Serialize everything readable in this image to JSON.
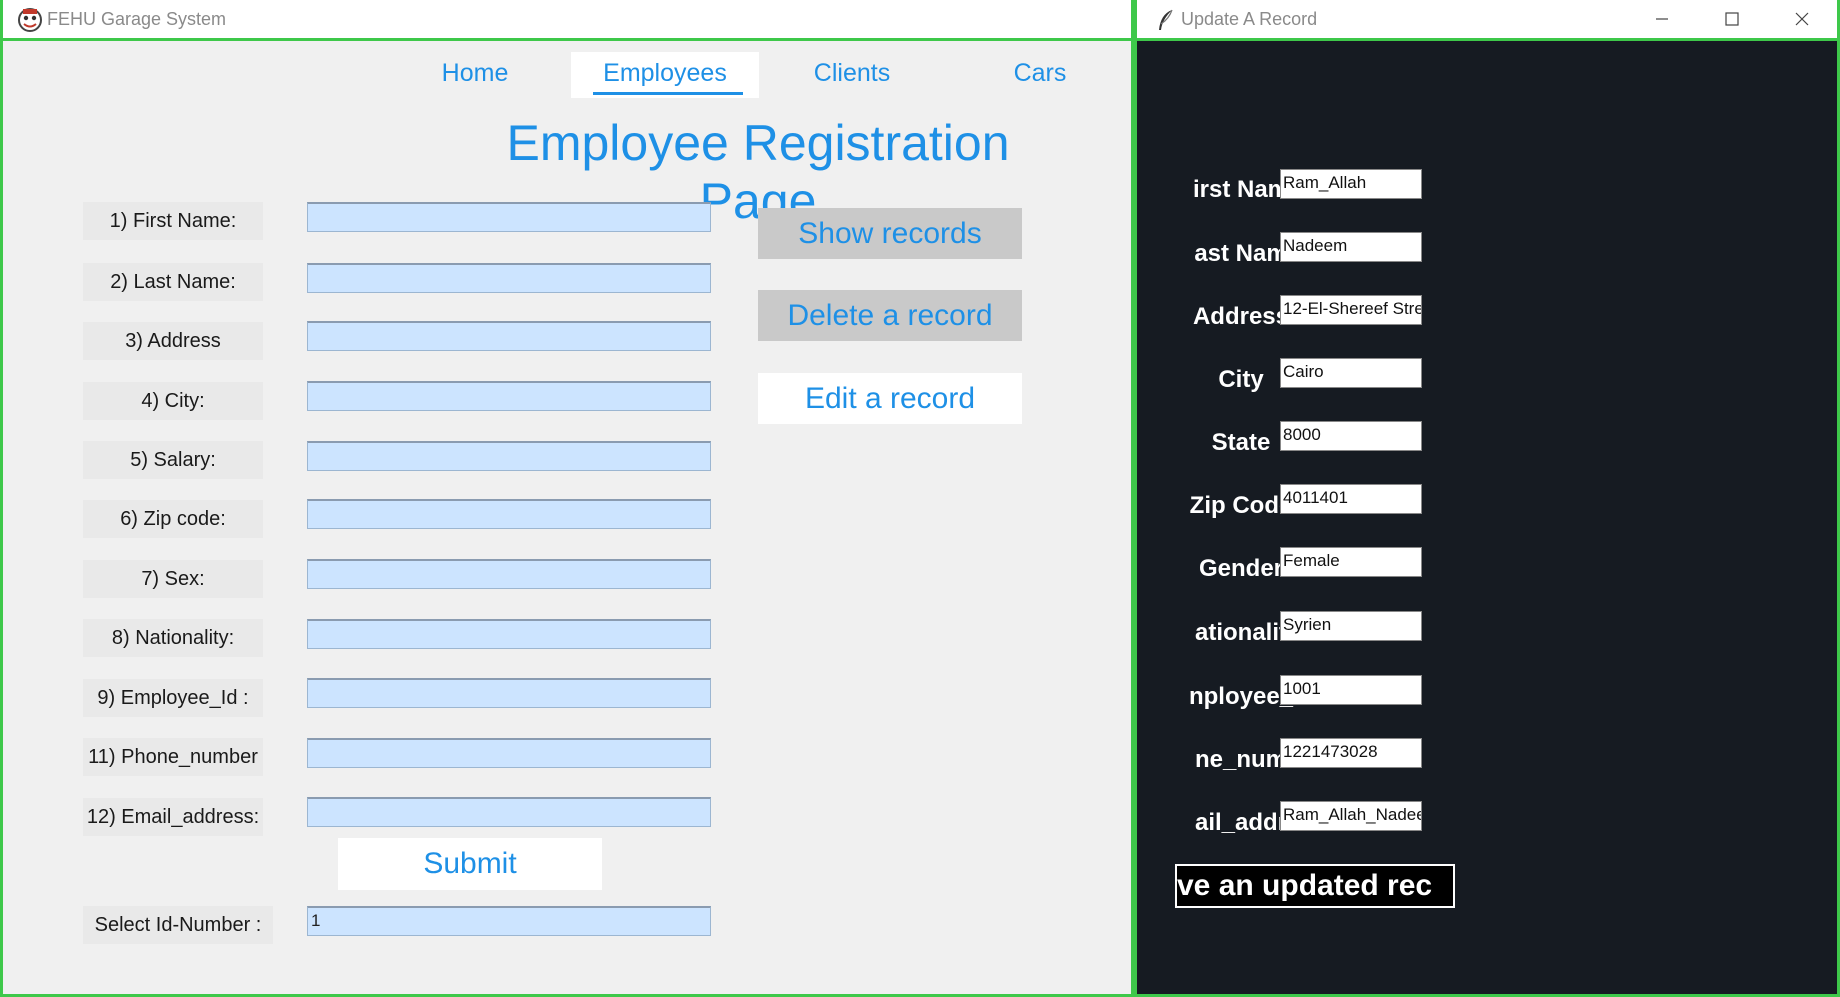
{
  "left_window": {
    "title": "FEHU Garage System",
    "tabs": [
      {
        "label": "Home",
        "active": false
      },
      {
        "label": "Employees",
        "active": true
      },
      {
        "label": "Clients",
        "active": false
      },
      {
        "label": "Cars",
        "active": false
      }
    ],
    "page_title": "Employee Registration Page",
    "form_fields": [
      {
        "label": "1) First Name:",
        "value": ""
      },
      {
        "label": "2) Last Name:",
        "value": ""
      },
      {
        "label": "3) Address",
        "value": ""
      },
      {
        "label": "4) City:",
        "value": ""
      },
      {
        "label": "5) Salary:",
        "value": ""
      },
      {
        "label": "6) Zip code:",
        "value": ""
      },
      {
        "label": "7) Sex:",
        "value": ""
      },
      {
        "label": "8) Nationality:",
        "value": ""
      },
      {
        "label": "9) Employee_Id :",
        "value": ""
      },
      {
        "label": "11) Phone_number",
        "value": ""
      },
      {
        "label": "12) Email_address:",
        "value": ""
      }
    ],
    "actions": {
      "show_records": "Show records",
      "delete_record": "Delete a record",
      "edit_record": "Edit a record"
    },
    "submit_label": "Submit",
    "select_id": {
      "label": "Select Id-Number :",
      "value": "1"
    }
  },
  "right_window": {
    "title": "Update A Record",
    "fields": [
      {
        "label": "irst Nam",
        "value": "Ram_Allah"
      },
      {
        "label": "ast Nam",
        "value": "Nadeem"
      },
      {
        "label": "Address",
        "value": "12-El-Shereef Stre"
      },
      {
        "label": "City",
        "value": "Cairo"
      },
      {
        "label": "State",
        "value": "8000"
      },
      {
        "label": "Zip Code",
        "value": "4011401"
      },
      {
        "label": "Gender",
        "value": "Female"
      },
      {
        "label": "ationalit",
        "value": "Syrien"
      },
      {
        "label": "nployee_",
        "value": "1001"
      },
      {
        "label": "ne_num",
        "value": "1221473028"
      },
      {
        "label": "ail_addr",
        "value": "Ram_Allah_Nadee"
      }
    ],
    "save_label": "ve an updated rec"
  },
  "colors": {
    "accent": "#1e90e6",
    "frame": "#3ec84a",
    "input_bg": "#cce4ff",
    "dark_bg": "#161b22"
  }
}
